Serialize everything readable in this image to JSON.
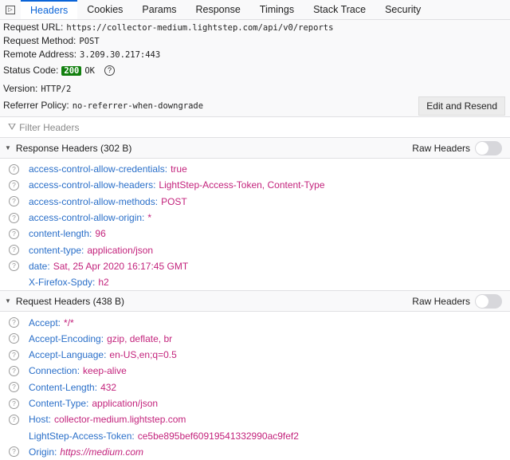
{
  "tabs": [
    "Headers",
    "Cookies",
    "Params",
    "Response",
    "Timings",
    "Stack Trace",
    "Security"
  ],
  "summary": {
    "url_label": "Request URL:",
    "url": "https://collector-medium.lightstep.com/api/v0/reports",
    "method_label": "Request Method:",
    "method": "POST",
    "remote_label": "Remote Address:",
    "remote": "3.209.30.217:443",
    "status_label": "Status Code:",
    "status_code": "200",
    "status_text": "OK",
    "version_label": "Version:",
    "version": "HTTP/2",
    "referrer_label": "Referrer Policy:",
    "referrer": "no-referrer-when-downgrade",
    "resend_label": "Edit and Resend"
  },
  "filter": {
    "placeholder": "Filter Headers"
  },
  "response": {
    "title": "Response Headers (302 B)",
    "raw_label": "Raw Headers",
    "headers": [
      {
        "name": "access-control-allow-credentials:",
        "value": "true",
        "help": true
      },
      {
        "name": "access-control-allow-headers:",
        "value": "LightStep-Access-Token, Content-Type",
        "help": true
      },
      {
        "name": "access-control-allow-methods:",
        "value": "POST",
        "help": true
      },
      {
        "name": "access-control-allow-origin:",
        "value": "*",
        "help": true
      },
      {
        "name": "content-length:",
        "value": "96",
        "help": true
      },
      {
        "name": "content-type:",
        "value": "application/json",
        "help": true
      },
      {
        "name": "date:",
        "value": "Sat, 25 Apr 2020 16:17:45 GMT",
        "help": true
      },
      {
        "name": "X-Firefox-Spdy:",
        "value": "h2",
        "help": false
      }
    ]
  },
  "request": {
    "title": "Request Headers (438 B)",
    "raw_label": "Raw Headers",
    "headers": [
      {
        "name": "Accept:",
        "value": "*/*",
        "help": true
      },
      {
        "name": "Accept-Encoding:",
        "value": "gzip, deflate, br",
        "help": true
      },
      {
        "name": "Accept-Language:",
        "value": "en-US,en;q=0.5",
        "help": true
      },
      {
        "name": "Connection:",
        "value": "keep-alive",
        "help": true
      },
      {
        "name": "Content-Length:",
        "value": "432",
        "help": true
      },
      {
        "name": "Content-Type:",
        "value": "application/json",
        "help": true
      },
      {
        "name": "Host:",
        "value": "collector-medium.lightstep.com",
        "help": true
      },
      {
        "name": "LightStep-Access-Token:",
        "value": "ce5be895bef60919541332990ac9fef2",
        "help": false
      },
      {
        "name": "Origin:",
        "value": "https://medium.com",
        "help": true,
        "italic": true
      }
    ]
  }
}
